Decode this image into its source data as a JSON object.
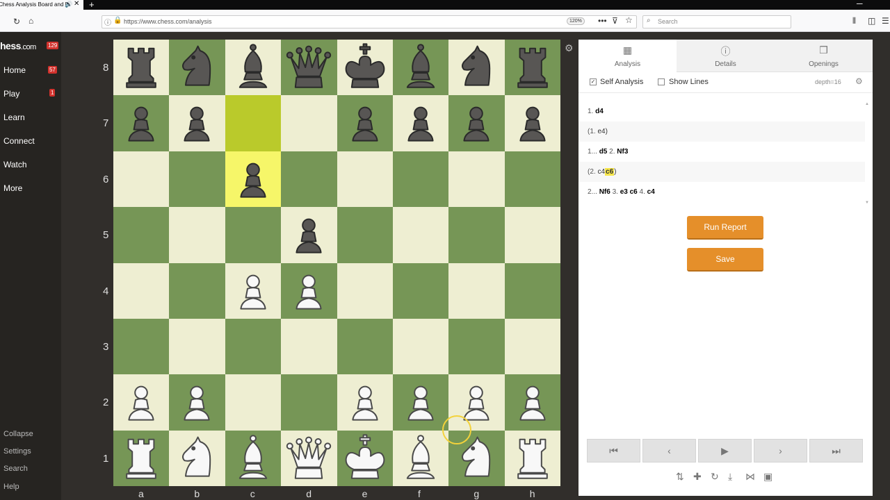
{
  "browser": {
    "tab_title": "Chess Analysis Board and P",
    "new_tab": "+",
    "minimize": "─",
    "url": "https://www.chess.com/analysis",
    "zoom": "120%",
    "search_placeholder": "Search"
  },
  "sidebar": {
    "logo": "hess",
    "logo_suffix": ".com",
    "logo_badge": "129",
    "items": [
      {
        "label": "Home",
        "badge": "57"
      },
      {
        "label": "Play",
        "badge": "1"
      },
      {
        "label": "Learn"
      },
      {
        "label": "Connect"
      },
      {
        "label": "Watch"
      },
      {
        "label": "More"
      }
    ],
    "bottom": [
      "Collapse",
      "Settings",
      "Search",
      "Help"
    ]
  },
  "board": {
    "ranks": [
      "8",
      "7",
      "6",
      "5",
      "4",
      "3",
      "2",
      "1"
    ],
    "files": [
      "a",
      "b",
      "c",
      "d",
      "e",
      "f",
      "g",
      "h"
    ],
    "position": [
      "rnbqkbnr",
      "pp..pppp",
      "..p.....",
      "...p....",
      "..PP....",
      "........",
      "PP..PPPP",
      "RNBQKBNR"
    ],
    "highlight": [
      "c7",
      "c6"
    ]
  },
  "panel": {
    "tabs": [
      {
        "label": "Analysis",
        "icon": "analysis-icon",
        "active": true
      },
      {
        "label": "Details",
        "icon": "info-icon",
        "active": false
      },
      {
        "label": "Openings",
        "icon": "book-icon",
        "active": false
      }
    ],
    "self_analysis": "Self Analysis",
    "self_analysis_checked": true,
    "show_lines": "Show Lines",
    "show_lines_checked": false,
    "depth": "depth=16",
    "moves": [
      {
        "variation": false,
        "parts": [
          [
            "num",
            "1."
          ],
          [
            "move",
            "d4"
          ]
        ]
      },
      {
        "variation": true,
        "parts": [
          [
            "num",
            "(1."
          ],
          [
            "plain",
            "e4)"
          ]
        ]
      },
      {
        "variation": false,
        "parts": [
          [
            "num",
            "1..."
          ],
          [
            "move",
            "d5"
          ],
          [
            "num",
            "2."
          ],
          [
            "move",
            "Nf3"
          ]
        ]
      },
      {
        "variation": true,
        "parts": [
          [
            "num",
            "(2."
          ],
          [
            "plain",
            "c4"
          ],
          [
            "cur",
            "c6"
          ],
          [
            "plain",
            ")"
          ]
        ]
      },
      {
        "variation": false,
        "parts": [
          [
            "num",
            "2..."
          ],
          [
            "move",
            "Nf6"
          ],
          [
            "num",
            "3."
          ],
          [
            "move",
            "e3"
          ],
          [
            "move",
            "c6"
          ],
          [
            "num",
            "4."
          ],
          [
            "move",
            "c4"
          ]
        ]
      }
    ],
    "run_report": "Run Report",
    "save": "Save"
  },
  "colors": {
    "light_square": "#eeeed2",
    "dark_square": "#769656",
    "highlight": "#f6f669",
    "button_orange": "#e58f2a"
  }
}
